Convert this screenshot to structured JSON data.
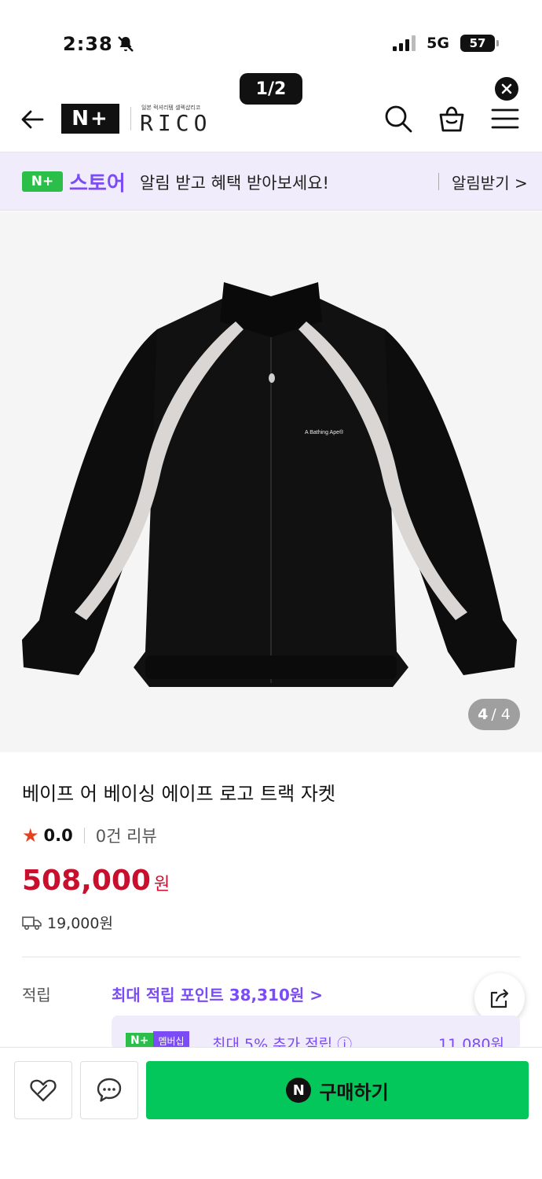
{
  "status_bar": {
    "time": "2:38",
    "network": "5G",
    "battery": "57"
  },
  "page_counter": "1/2",
  "header": {
    "logo_np": "N+",
    "logo_sub": "일본 럭셔리템 셀렉샵리코",
    "logo_brand": "RICO"
  },
  "banner": {
    "badge": "N+",
    "store": "스토어",
    "message": "알림 받고 혜택 받아보세요!",
    "action": "알림받기 >"
  },
  "image": {
    "counter_current": "4",
    "counter_total": "/ 4",
    "jacket_print": "A Bathing Ape®"
  },
  "product": {
    "title": "베이프 어 베이싱 에이프 로고 트랙 자켓",
    "rating": "0.0",
    "reviews": "0건 리뷰",
    "price": "508,000",
    "price_unit": "원",
    "shipping": "19,000원"
  },
  "points": {
    "label": "적립",
    "value": "최대 적립 포인트 38,310원 >"
  },
  "membership": {
    "badge_np": "N+",
    "badge_label": "멤버십",
    "text": "최대 5% 추가 적립 ⓘ",
    "amount": "11,080원"
  },
  "bottom_bar": {
    "buy_logo": "N",
    "buy_label": "구매하기"
  },
  "colors": {
    "accent_purple": "#7b4cf5",
    "naver_green": "#03c75a",
    "price_red": "#c8102e"
  }
}
